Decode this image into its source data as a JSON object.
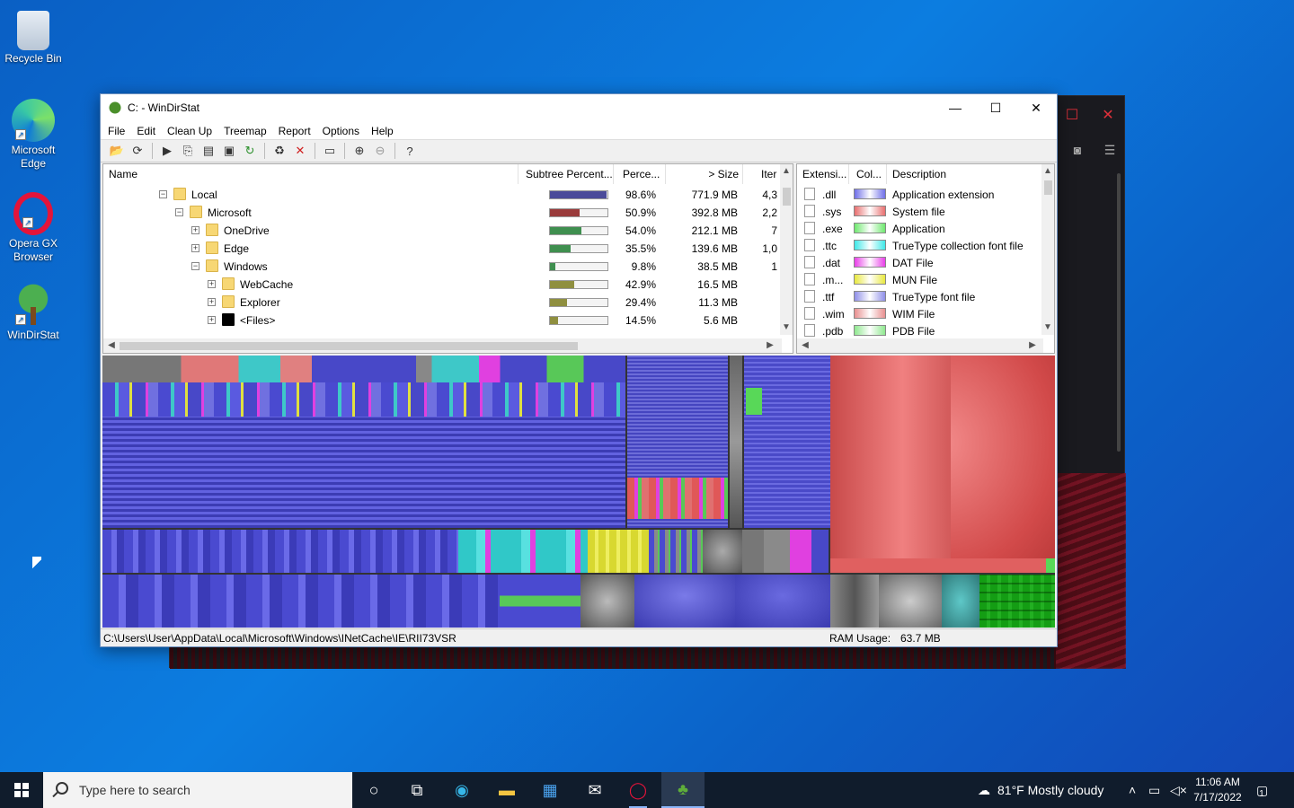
{
  "desktop": {
    "icons": [
      {
        "label": "Recycle Bin"
      },
      {
        "label": "Microsoft Edge"
      },
      {
        "label": "Opera GX Browser"
      },
      {
        "label": "WinDirStat"
      }
    ]
  },
  "window": {
    "title": "C: - WinDirStat",
    "menu": [
      "File",
      "Edit",
      "Clean Up",
      "Treemap",
      "Report",
      "Options",
      "Help"
    ],
    "tree": {
      "headers": {
        "name": "Name",
        "subtree": "Subtree Percent...",
        "percent": "Perce...",
        "size": "> Size",
        "items": "Iter"
      },
      "rows": [
        {
          "name": "Local",
          "fill": 0.986,
          "fill_color": "#4b4b9a",
          "percent": "98.6%",
          "size": "771.9 MB",
          "items": "4,3",
          "expander": "−"
        },
        {
          "name": "Microsoft",
          "fill": 0.509,
          "fill_color": "#9a3b3b",
          "percent": "50.9%",
          "size": "392.8 MB",
          "items": "2,2",
          "expander": "−"
        },
        {
          "name": "OneDrive",
          "fill": 0.54,
          "fill_color": "#3f8f4f",
          "percent": "54.0%",
          "size": "212.1 MB",
          "items": "7",
          "expander": "+"
        },
        {
          "name": "Edge",
          "fill": 0.355,
          "fill_color": "#3f8f4f",
          "percent": "35.5%",
          "size": "139.6 MB",
          "items": "1,0",
          "expander": "+"
        },
        {
          "name": "Windows",
          "fill": 0.098,
          "fill_color": "#3f8f4f",
          "percent": "9.8%",
          "size": "38.5 MB",
          "items": "1",
          "expander": "−"
        },
        {
          "name": "WebCache",
          "fill": 0.429,
          "fill_color": "#8f8f3f",
          "percent": "42.9%",
          "size": "16.5 MB",
          "items": "",
          "expander": "+"
        },
        {
          "name": "Explorer",
          "fill": 0.294,
          "fill_color": "#8f8f3f",
          "percent": "29.4%",
          "size": "11.3 MB",
          "items": "",
          "expander": "+"
        },
        {
          "name": "<Files>",
          "fill": 0.145,
          "fill_color": "#8f8f3f",
          "percent": "14.5%",
          "size": "5.6 MB",
          "items": "",
          "expander": "+"
        }
      ]
    },
    "extensions": {
      "headers": {
        "ext": "Extensi...",
        "color": "Col...",
        "desc": "Description"
      },
      "rows": [
        {
          "ext": ".dll",
          "color": "#6f6fe8",
          "desc": "Application extension"
        },
        {
          "ext": ".sys",
          "color": "#e86f6f",
          "desc": "System file"
        },
        {
          "ext": ".exe",
          "color": "#6fe86f",
          "desc": "Application"
        },
        {
          "ext": ".ttc",
          "color": "#3fe8e8",
          "desc": "TrueType collection font file"
        },
        {
          "ext": ".dat",
          "color": "#e83fe8",
          "desc": "DAT File"
        },
        {
          "ext": ".m...",
          "color": "#e8e83f",
          "desc": "MUN File"
        },
        {
          "ext": ".ttf",
          "color": "#8f8fe8",
          "desc": "TrueType font file"
        },
        {
          "ext": ".wim",
          "color": "#e88f8f",
          "desc": "WIM File"
        },
        {
          "ext": ".pdb",
          "color": "#8fe88f",
          "desc": "PDB File"
        }
      ]
    },
    "status": {
      "path": "C:\\Users\\User\\AppData\\Local\\Microsoft\\Windows\\INetCache\\IE\\RII73VSR",
      "ram_label": "RAM Usage:",
      "ram_value": "63.7 MB"
    }
  },
  "taskbar": {
    "search_placeholder": "Type here to search",
    "weather": "81°F  Mostly cloudy",
    "time": "11:06 AM",
    "date": "7/17/2022",
    "notification_count": "1"
  }
}
